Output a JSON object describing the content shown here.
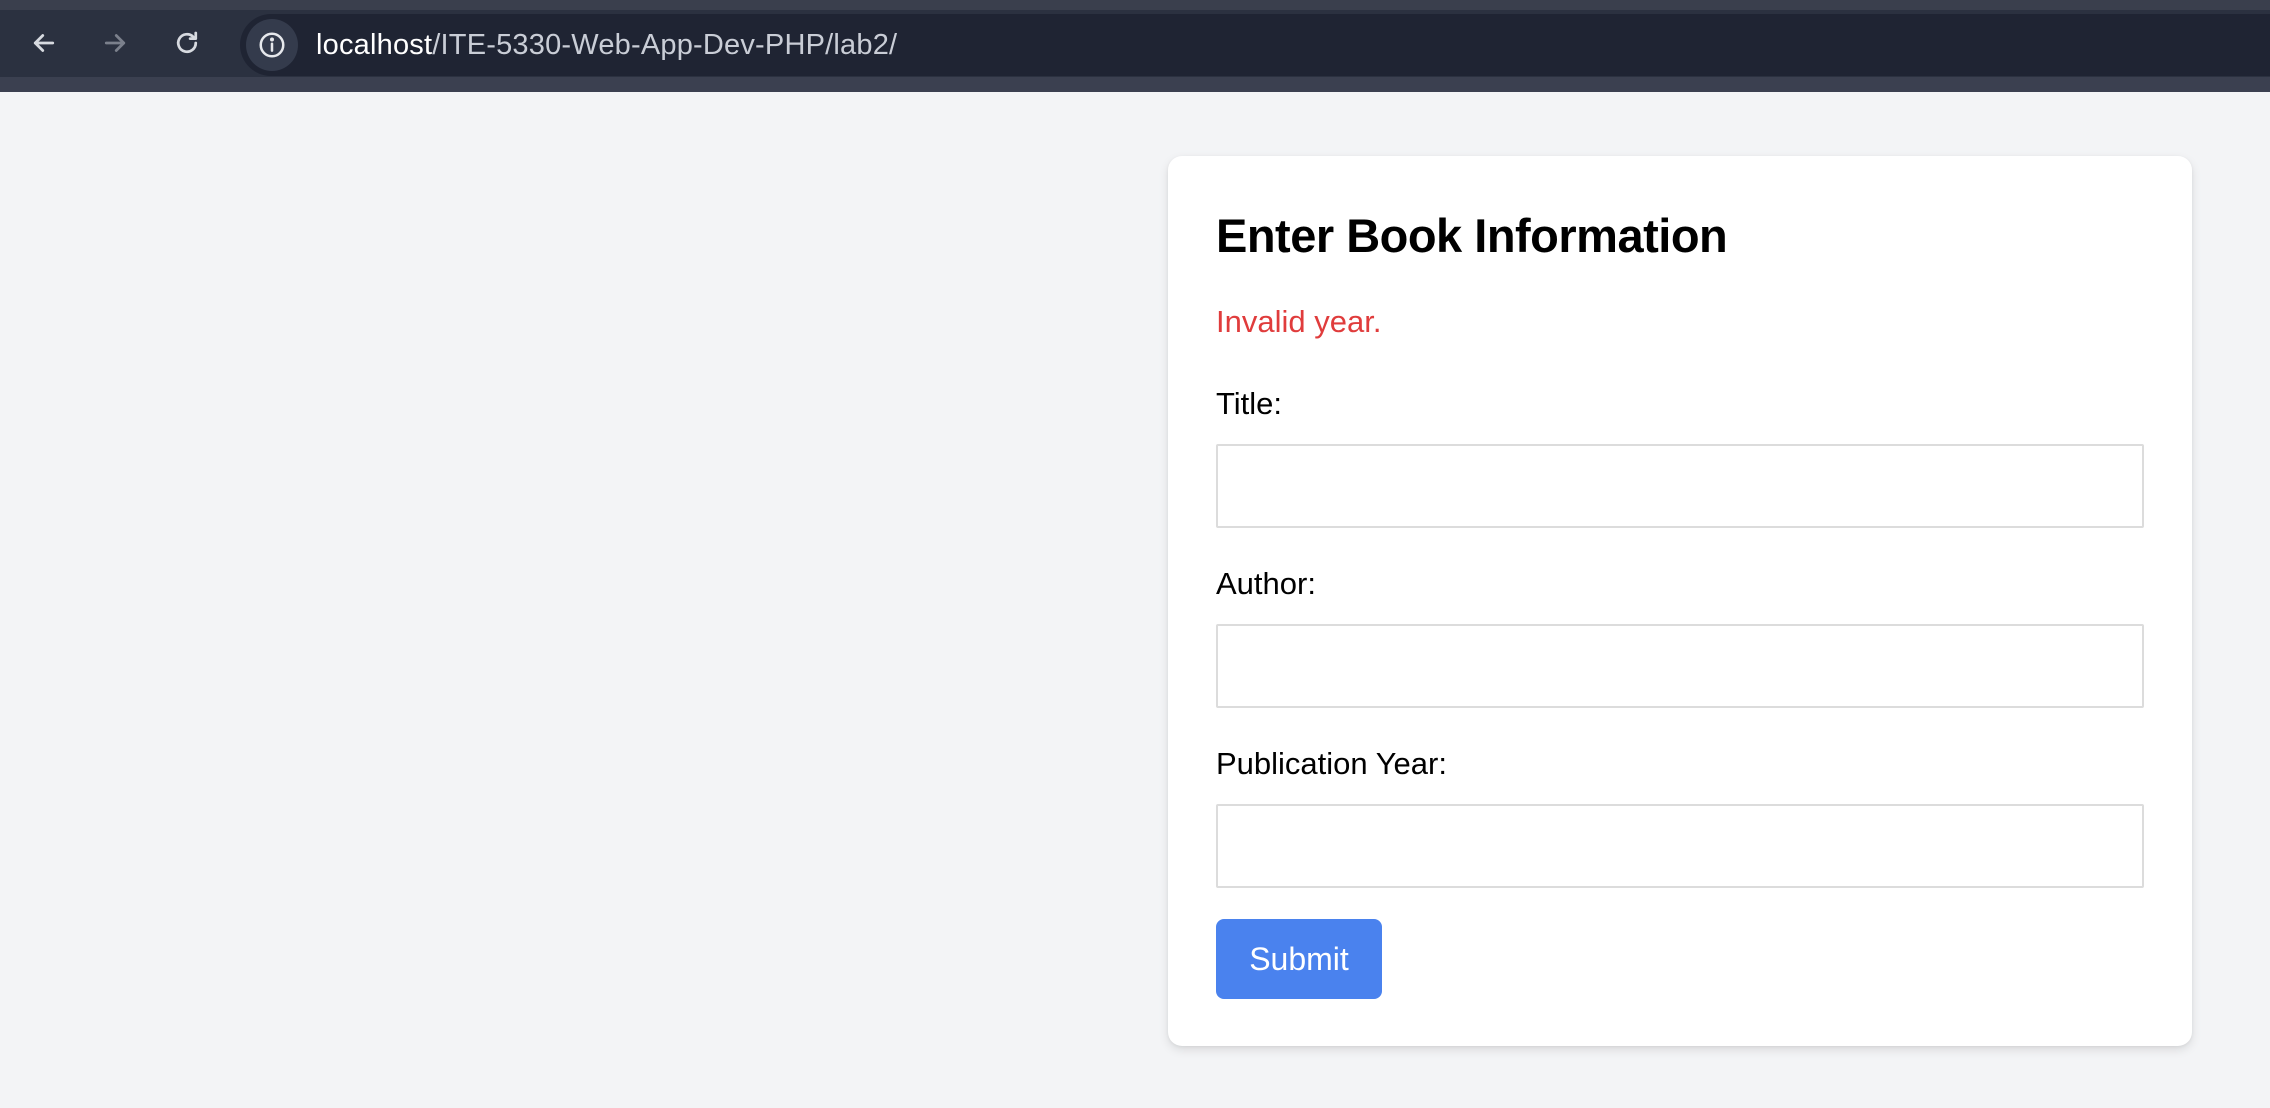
{
  "browser": {
    "url_host": "localhost",
    "url_path": "/ITE-5330-Web-App-Dev-PHP/lab2/",
    "icons": {
      "back": "back-arrow-icon",
      "forward": "forward-arrow-icon",
      "reload": "reload-icon",
      "site_info": "info-icon"
    }
  },
  "form": {
    "title": "Enter Book Information",
    "error": "Invalid year.",
    "fields": [
      {
        "label": "Title:",
        "value": ""
      },
      {
        "label": "Author:",
        "value": ""
      },
      {
        "label": "Publication Year:",
        "value": ""
      }
    ],
    "submit_label": "Submit"
  },
  "colors": {
    "error": "#e03c3c",
    "submit_bg": "#4a82ee",
    "page_bg": "#f3f4f6",
    "chrome_bg": "#2b3140"
  }
}
